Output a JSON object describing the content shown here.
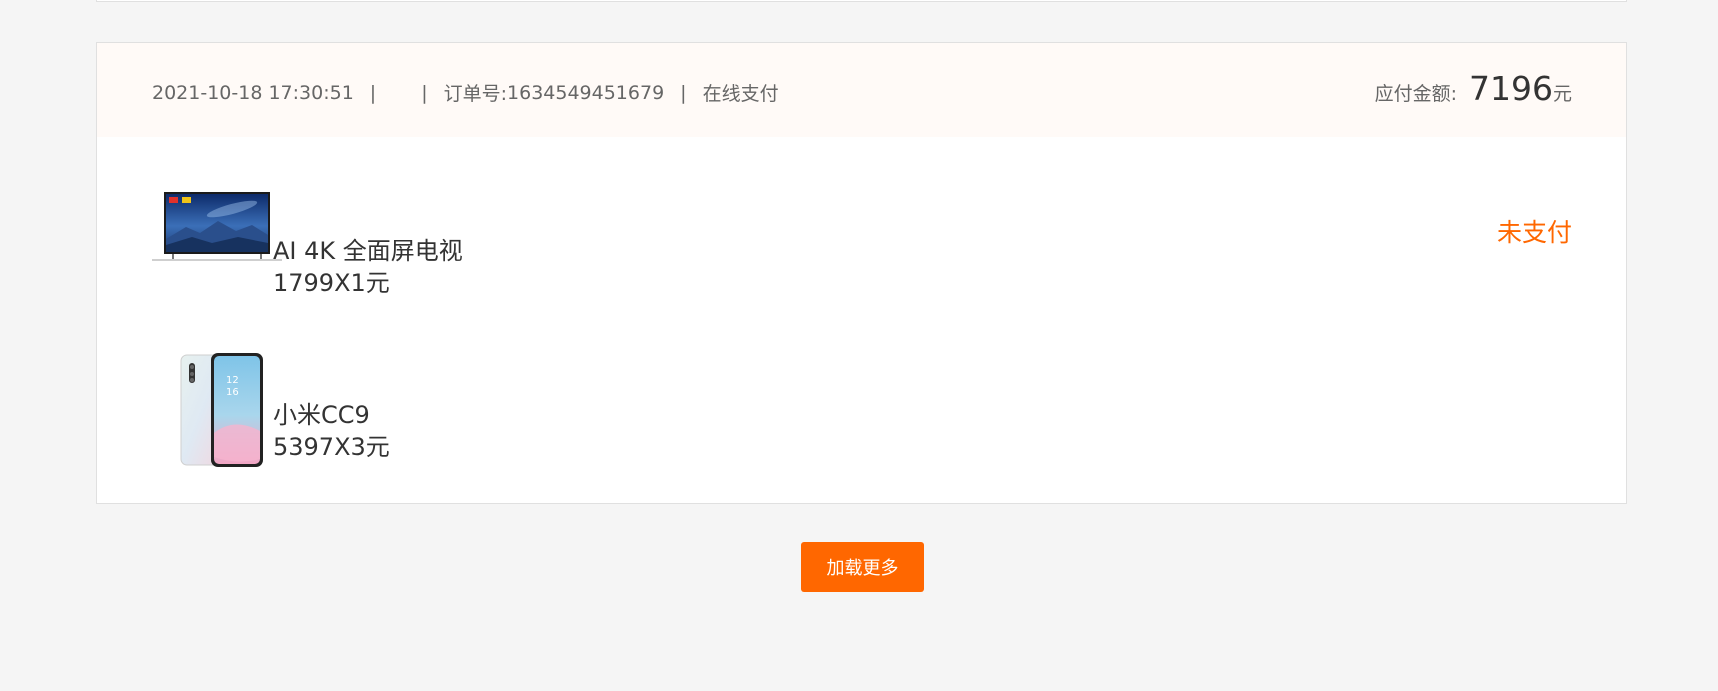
{
  "order": {
    "datetime": "2021-10-18 17:30:51",
    "separator": "|",
    "order_no_label": "订单号:",
    "order_no": "1634549451679",
    "payment_method": "在线支付",
    "amount_label": "应付金额:",
    "amount_value": "7196",
    "amount_unit": "元",
    "status": "未支付",
    "items": [
      {
        "name": "AI 4K 全面屏电视",
        "price": "1799X1元",
        "icon": "tv-product-image"
      },
      {
        "name": "小米CC9",
        "price": "5397X3元",
        "icon": "phone-product-image"
      }
    ]
  },
  "load_more_label": "加载更多",
  "colors": {
    "accent": "#ff6700",
    "header_bg": "#fffaf7",
    "page_bg": "#f5f5f5"
  }
}
